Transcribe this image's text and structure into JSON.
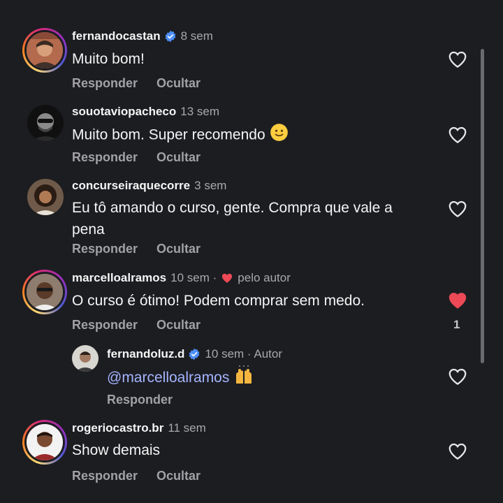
{
  "comments": [
    {
      "username": "fernandocastan",
      "verified": true,
      "time": "8 sem",
      "text": "Muito bom!",
      "reply": "Responder",
      "hide": "Ocultar",
      "liked": false
    },
    {
      "username": "souotaviopacheco",
      "verified": false,
      "time": "13 sem",
      "text": "Muito bom. Super recomendo",
      "emoji": "slightly-smiling-face",
      "reply": "Responder",
      "hide": "Ocultar",
      "liked": false
    },
    {
      "username": "concurseiraquecorre",
      "verified": false,
      "time": "3 sem",
      "text": "Eu tô amando o curso, gente. Compra que vale a pena",
      "reply": "Responder",
      "hide": "Ocultar",
      "liked": false
    },
    {
      "username": "marcelloalramos",
      "verified": false,
      "time": "10 sem ·",
      "by_author": "pelo autor",
      "text": "O curso é ótimo! Podem comprar sem medo.",
      "reply": "Responder",
      "hide": "Ocultar",
      "liked": true,
      "like_count": "1"
    },
    {
      "username": "fernandoluz.d",
      "verified": true,
      "time": "10 sem · Autor",
      "mention": "@marcelloalramos",
      "emoji": "raising-hands",
      "reply": "Responder",
      "liked": false
    },
    {
      "username": "rogeriocastro.br",
      "verified": false,
      "time": "11 sem",
      "text": "Show demais",
      "reply": "Responder",
      "hide": "Ocultar",
      "liked": false
    }
  ],
  "colors": {
    "background": "#1c1d21",
    "like_red": "#ed4956",
    "verified_blue": "#4d8ef7",
    "mention": "#a5b4ff"
  }
}
